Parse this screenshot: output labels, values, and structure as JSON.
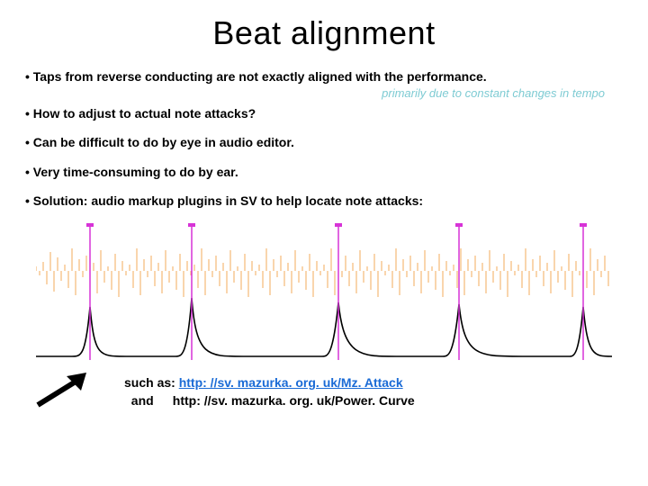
{
  "title": "Beat alignment",
  "bullets": [
    "Taps from reverse conducting are not exactly aligned with the performance.",
    "How to adjust to actual note attacks?",
    "Can be difficult to do by eye in audio editor.",
    "Very time-consuming to do by ear.",
    "Solution: audio markup plugins in SV to help locate note attacks:"
  ],
  "subnote": "primarily due to constant changes in tempo",
  "caption": {
    "lead": "such as: ",
    "link1": "http: //sv. mazurka. org. uk/Mz. Attack",
    "and": "and",
    "link2": "http: //sv. mazurka. org. uk/Power. Curve"
  }
}
